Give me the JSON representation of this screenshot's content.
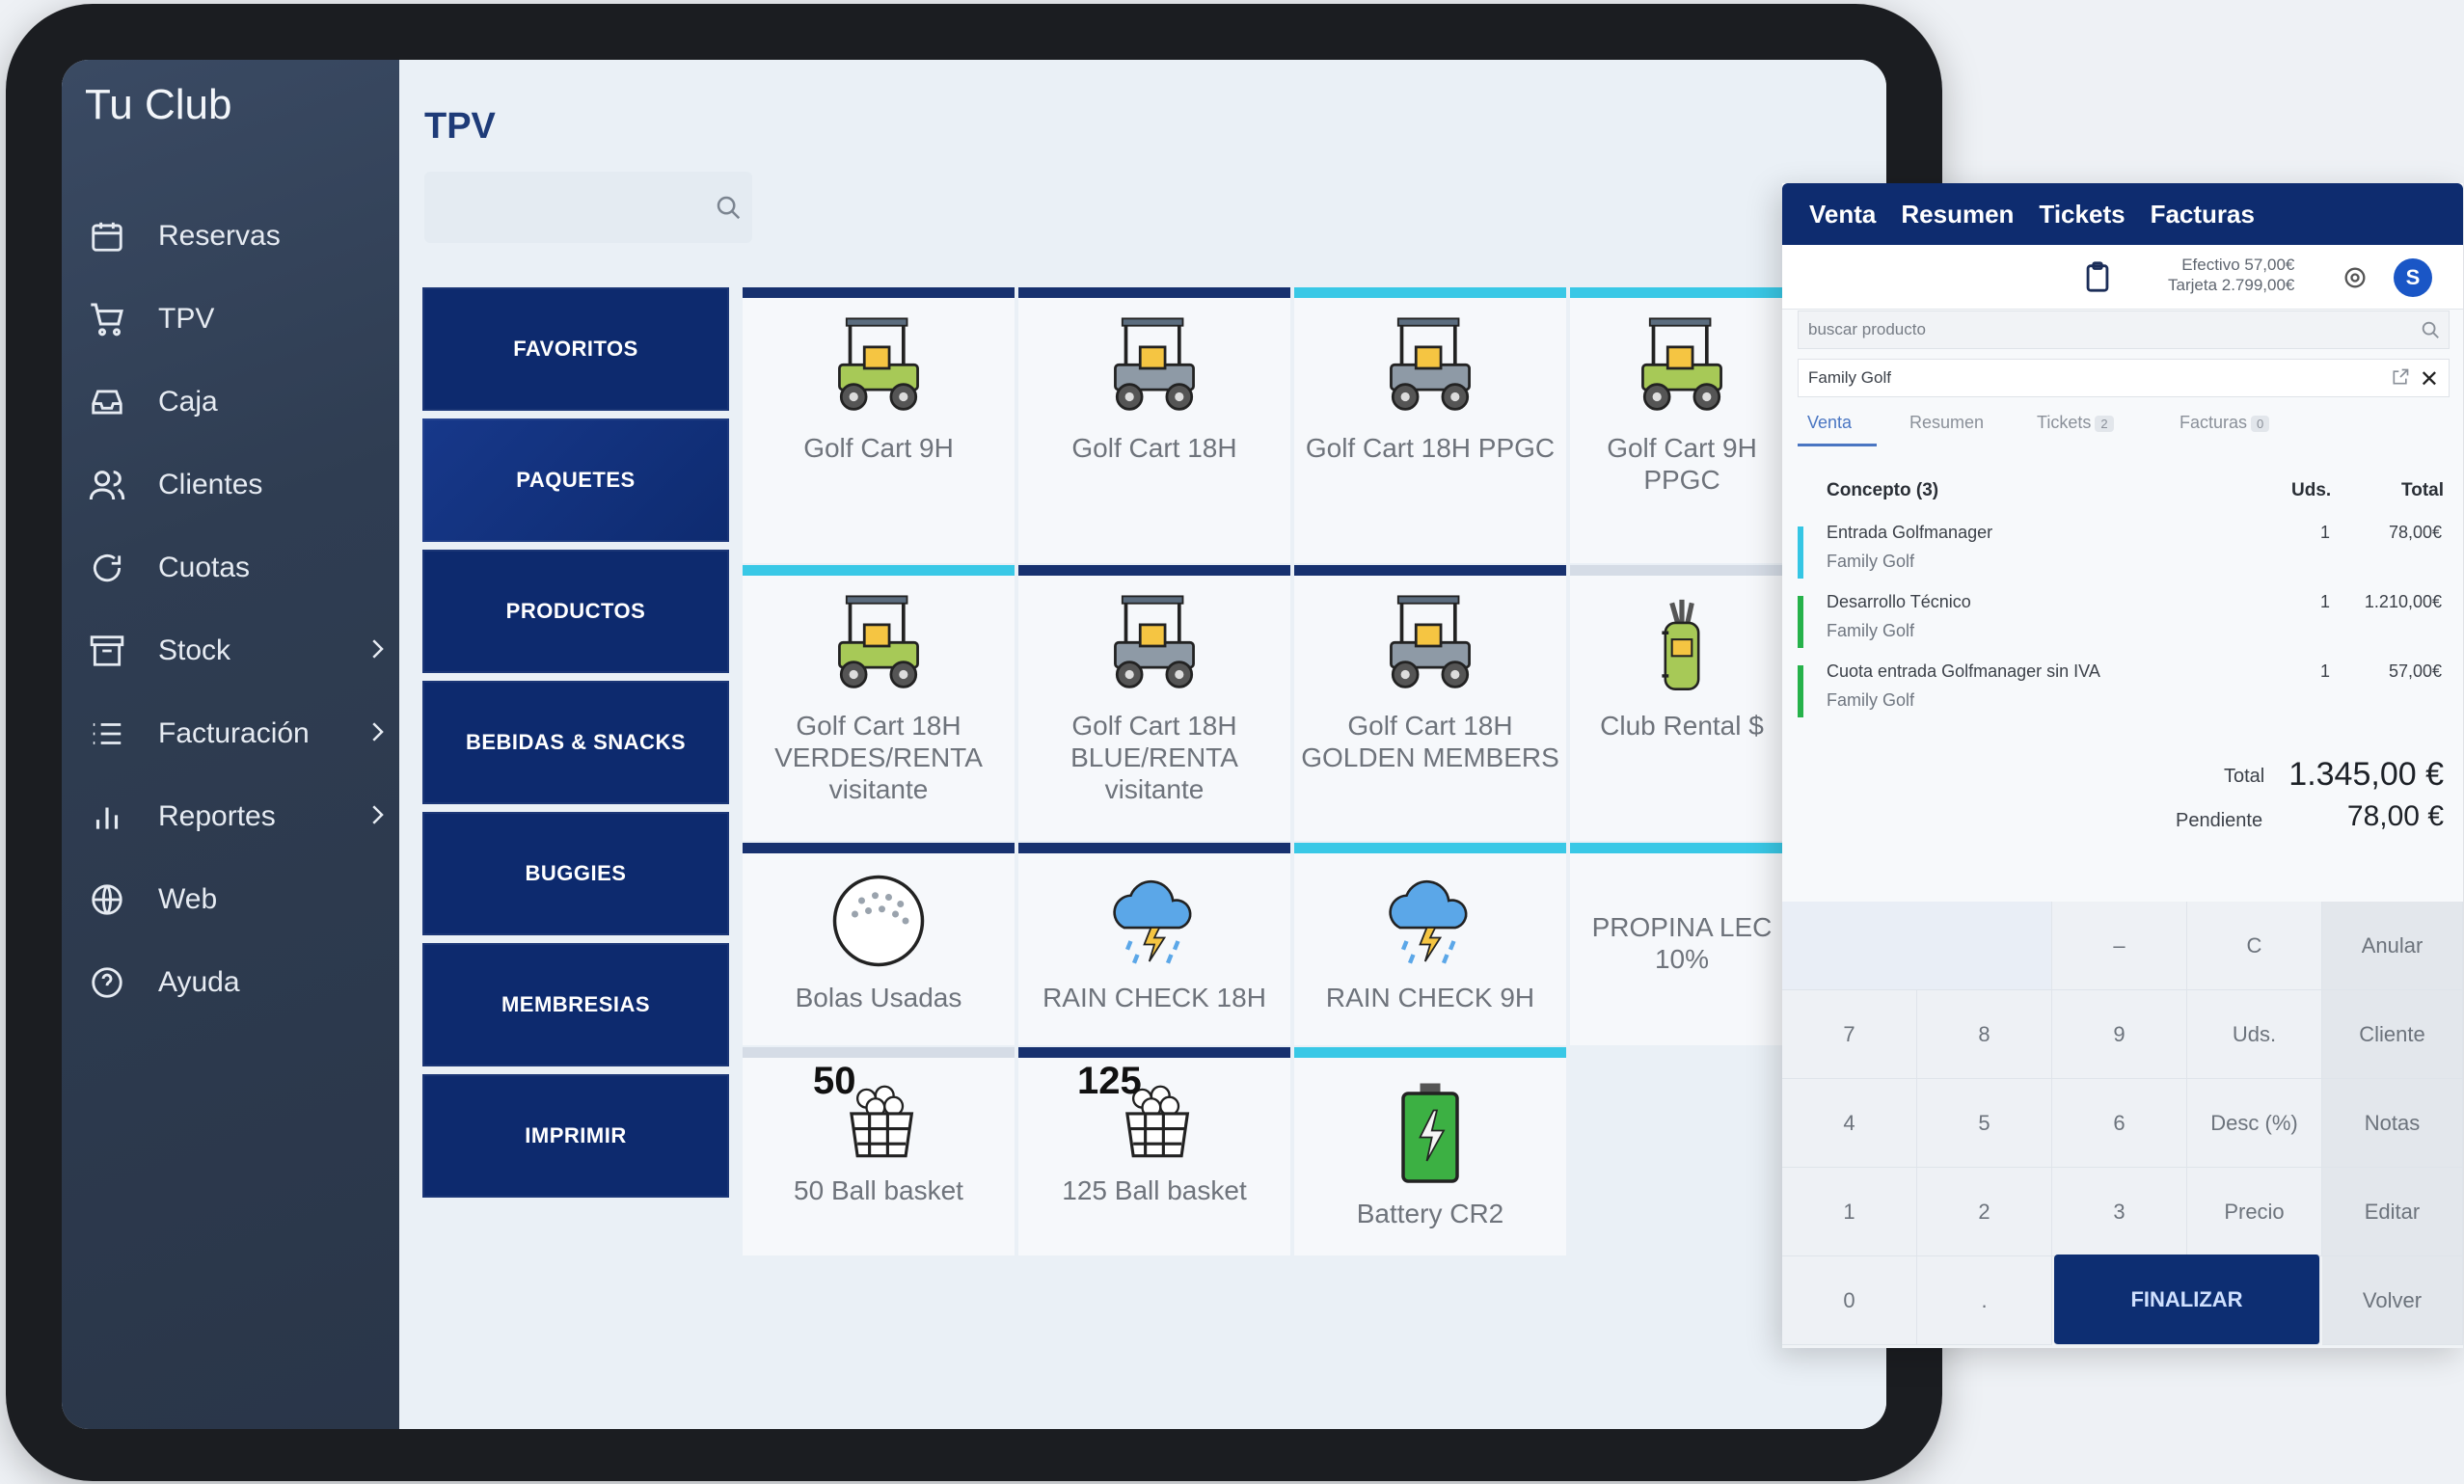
{
  "sidebar": {
    "brand": "Tu Club",
    "items": [
      {
        "label": "Reservas",
        "icon": "calendar-icon"
      },
      {
        "label": "TPV",
        "icon": "cart-icon"
      },
      {
        "label": "Caja",
        "icon": "inbox-icon"
      },
      {
        "label": "Clientes",
        "icon": "users-icon"
      },
      {
        "label": "Cuotas",
        "icon": "refresh-icon"
      },
      {
        "label": "Stock",
        "icon": "archive-icon",
        "chevron": true
      },
      {
        "label": "Facturación",
        "icon": "list-icon",
        "chevron": true
      },
      {
        "label": "Reportes",
        "icon": "bar-chart-icon",
        "chevron": true
      },
      {
        "label": "Web",
        "icon": "globe-icon"
      },
      {
        "label": "Ayuda",
        "icon": "help-icon"
      }
    ]
  },
  "main": {
    "title": "TPV",
    "search_placeholder": ""
  },
  "categories": [
    "FAVORITOS",
    "PAQUETES",
    "PRODUCTOS",
    "BEBIDAS & SNACKS",
    "BUGGIES",
    "MEMBRESIAS",
    "IMPRIMIR"
  ],
  "products": [
    {
      "name": "Golf Cart 9H",
      "icon": "golf-cart-icon"
    },
    {
      "name": "Golf Cart 18H",
      "icon": "golf-cart-icon"
    },
    {
      "name": "Golf Cart 18H PPGC",
      "icon": "golf-cart-icon"
    },
    {
      "name": "Golf Cart 9H PPGC",
      "icon": "golf-cart-icon"
    },
    {
      "name": "Golf Cart 18H VERDES/RENTA visitante",
      "icon": "golf-cart-icon"
    },
    {
      "name": "Golf Cart 18H BLUE/RENTA visitante",
      "icon": "golf-cart-icon"
    },
    {
      "name": "Golf Cart 18H GOLDEN MEMBERS",
      "icon": "golf-cart-icon"
    },
    {
      "name": "Club Rental $",
      "icon": "golf-bag-icon"
    },
    {
      "name": "Bolas Usadas",
      "icon": "golf-ball-icon"
    },
    {
      "name": "RAIN CHECK 18H",
      "icon": "storm-cloud-icon"
    },
    {
      "name": "RAIN CHECK 9H",
      "icon": "storm-cloud-icon"
    },
    {
      "name": "PROPINA LEC 10%",
      "icon": ""
    },
    {
      "name": "50 Ball basket",
      "icon": "ball-basket-icon",
      "badge": "50"
    },
    {
      "name": "125 Ball basket",
      "icon": "ball-basket-icon",
      "badge": "125"
    },
    {
      "name": "Battery CR2",
      "icon": "battery-icon"
    }
  ],
  "pos": {
    "top_tabs": [
      "Venta",
      "Resumen",
      "Tickets",
      "Facturas"
    ],
    "cash": "Efectivo 57,00€",
    "card": "Tarjeta 2.799,00€",
    "avatar": "S",
    "search_placeholder": "buscar producto",
    "customer": "Family Golf",
    "tabs": [
      {
        "label": "Venta"
      },
      {
        "label": "Resumen"
      },
      {
        "label": "Tickets",
        "count": "2"
      },
      {
        "label": "Facturas",
        "count": "0"
      }
    ],
    "columns": {
      "concept": "Concepto (3)",
      "units": "Uds.",
      "total": "Total"
    },
    "lines": [
      {
        "concept": "Entrada Golfmanager",
        "customer": "Family Golf",
        "units": "1",
        "total": "78,00€",
        "color": "#35c6e4"
      },
      {
        "concept": "Desarrollo Técnico",
        "customer": "Family Golf",
        "units": "1",
        "total": "1.210,00€",
        "color": "#26b24a"
      },
      {
        "concept": "Cuota entrada Golfmanager sin IVA",
        "customer": "Family Golf",
        "units": "1",
        "total": "57,00€",
        "color": "#26b24a"
      }
    ],
    "total_label": "Total",
    "total_value": "1.345,00 €",
    "pending_label": "Pendiente",
    "pending_value": "78,00 €",
    "keypad": {
      "row1": [
        "",
        "–",
        "C",
        "Anular"
      ],
      "row2": [
        "7",
        "8",
        "9",
        "Uds.",
        "Cliente"
      ],
      "row3": [
        "4",
        "5",
        "6",
        "Desc (%)",
        "Notas"
      ],
      "row4": [
        "1",
        "2",
        "3",
        "Precio",
        "Editar"
      ],
      "row5": [
        "0",
        ".",
        "FINALIZAR",
        "Volver"
      ]
    }
  }
}
